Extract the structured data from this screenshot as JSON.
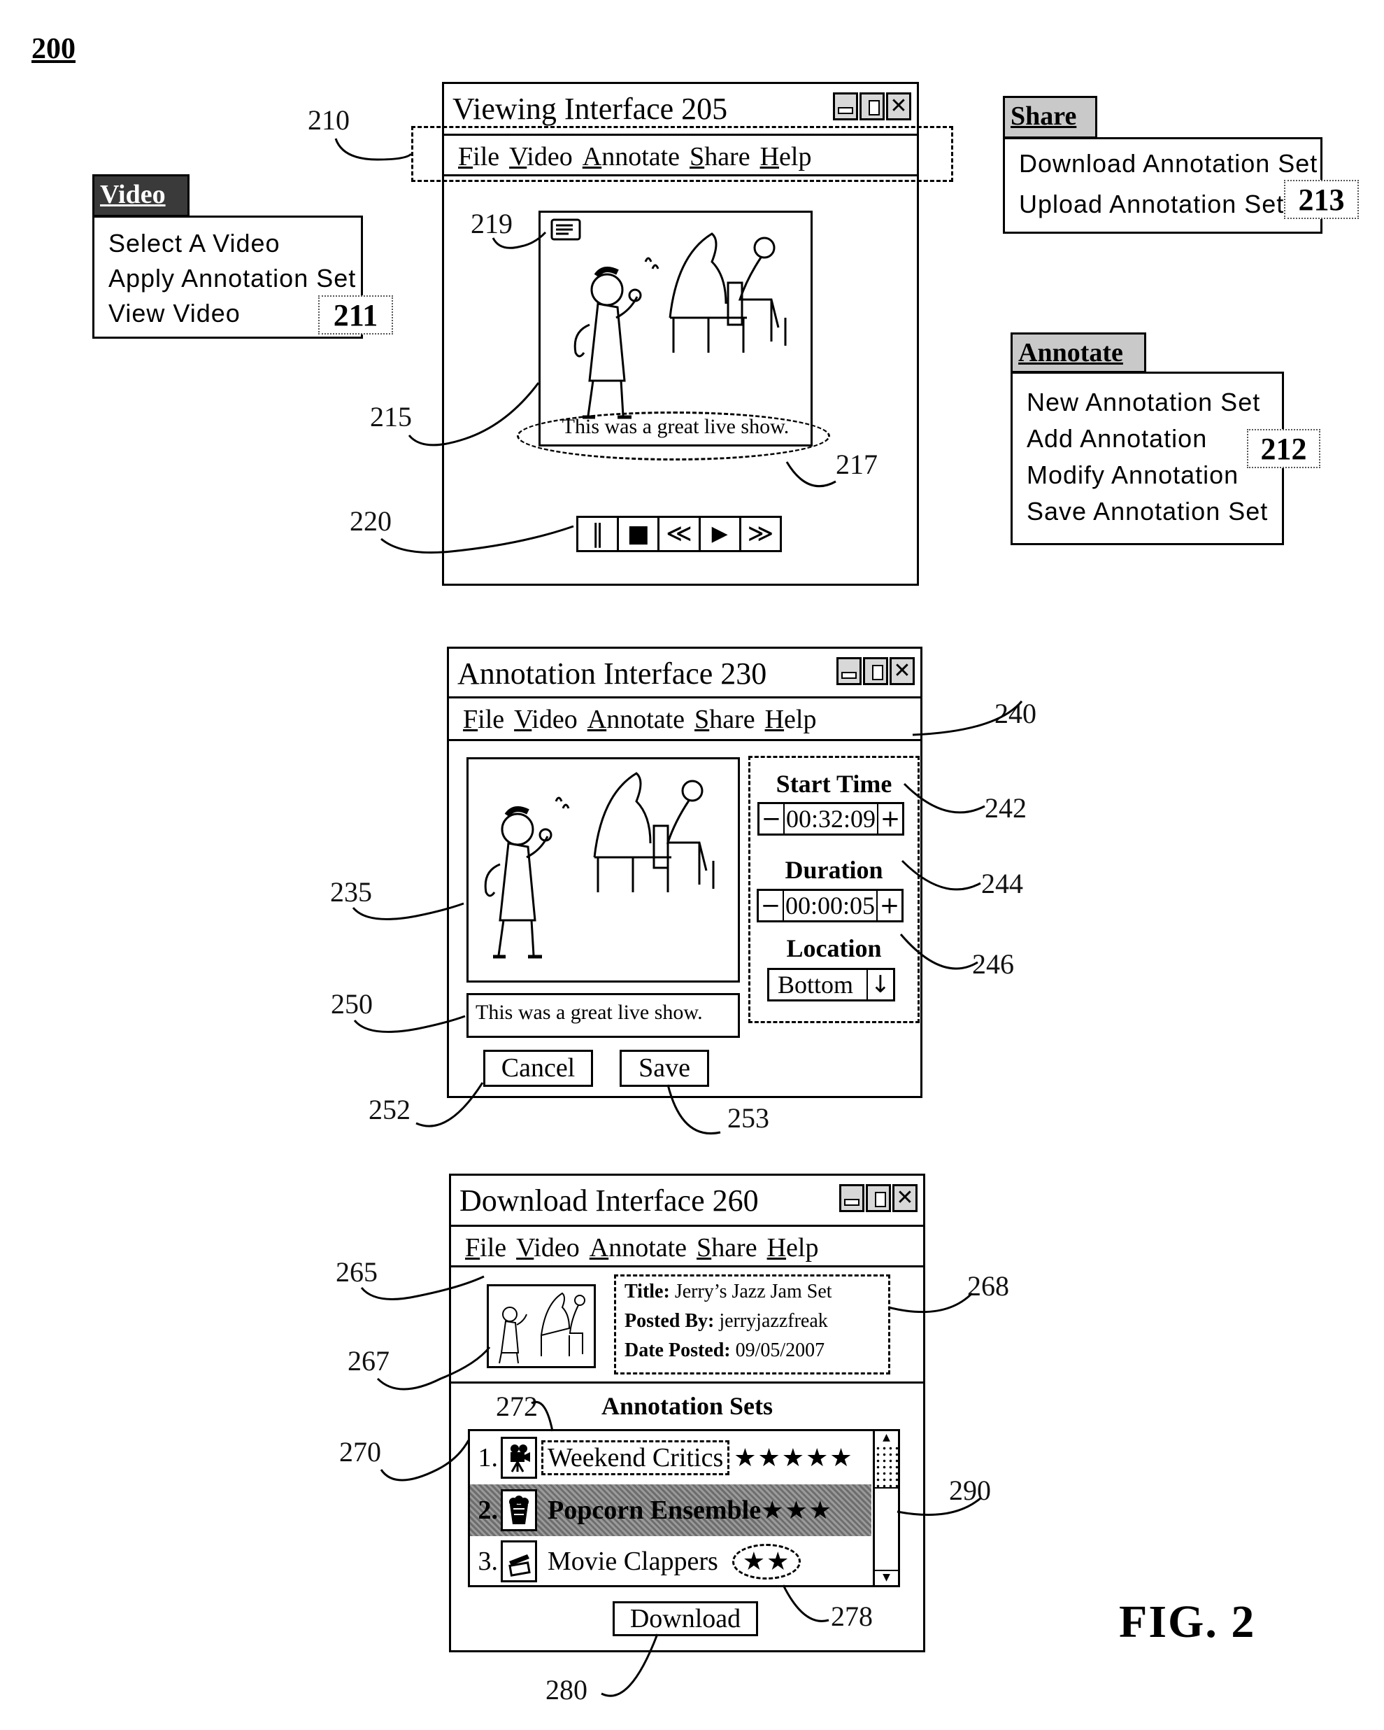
{
  "figure": {
    "number": "200",
    "caption": "FIG. 2"
  },
  "menu_labels": [
    "File",
    "Video",
    "Annotate",
    "Share",
    "Help"
  ],
  "viewing_interface": {
    "title": "Viewing Interface 205",
    "ref_menubar": "210",
    "ref_icon": "219",
    "ref_video": "215",
    "ref_caption": "217",
    "ref_controls": "220",
    "caption": "This was a great live show.",
    "controls": [
      {
        "name": "pause",
        "glyph": "‖"
      },
      {
        "name": "stop",
        "glyph": "■"
      },
      {
        "name": "rewind",
        "glyph": "≪"
      },
      {
        "name": "play",
        "glyph": "▶"
      },
      {
        "name": "fast-forward",
        "glyph": "≫"
      }
    ]
  },
  "video_menu": {
    "tab": "Video",
    "items": [
      "Select A Video",
      "Apply Annotation Set",
      "View Video"
    ],
    "ref": "211"
  },
  "share_menu": {
    "tab": "Share",
    "items": [
      "Download Annotation Set",
      "Upload Annotation Set"
    ],
    "ref": "213"
  },
  "annotate_menu": {
    "tab": "Annotate",
    "items": [
      "New Annotation Set",
      "Add Annotation",
      "Modify Annotation",
      "Save Annotation Set"
    ],
    "ref": "212"
  },
  "annotation_interface": {
    "title": "Annotation Interface 230",
    "ref_video": "235",
    "ref_panel": "240",
    "ref_start": "242",
    "ref_duration": "244",
    "ref_location": "246",
    "ref_textbox": "250",
    "ref_cancel": "252",
    "ref_save": "253",
    "start_time_label": "Start Time",
    "start_time_value": "00:32:09",
    "duration_label": "Duration",
    "duration_value": "00:00:05",
    "location_label": "Location",
    "location_value": "Bottom",
    "minus": "−",
    "plus": "+",
    "annotation_text": "This was a great live show.",
    "cancel_label": "Cancel",
    "save_label": "Save"
  },
  "download_interface": {
    "title": "Download Interface 260",
    "ref_info_area": "265",
    "ref_thumbnail": "267",
    "ref_info": "268",
    "ref_list": "270",
    "ref_set_name": "272",
    "ref_rating": "278",
    "ref_download": "280",
    "ref_selected": "290",
    "info": {
      "title_label": "Title:",
      "title_value": "Jerry’s Jazz Jam Set",
      "posted_by_label": "Posted By:",
      "posted_by_value": "jerryjazzfreak",
      "date_label": "Date Posted:",
      "date_value": "09/05/2007"
    },
    "sets_heading": "Annotation Sets",
    "sets": [
      {
        "num": "1.",
        "icon": "movie-camera",
        "name": "Weekend Critics",
        "stars": "★★★★★",
        "rating": 5,
        "selected": false
      },
      {
        "num": "2.",
        "icon": "popcorn",
        "name": "Popcorn Ensemble",
        "stars": "★★★",
        "rating": 3,
        "selected": true
      },
      {
        "num": "3.",
        "icon": "clapperboard",
        "name": "Movie Clappers",
        "stars": "★★",
        "rating": 2,
        "selected": false
      }
    ],
    "download_label": "Download"
  }
}
